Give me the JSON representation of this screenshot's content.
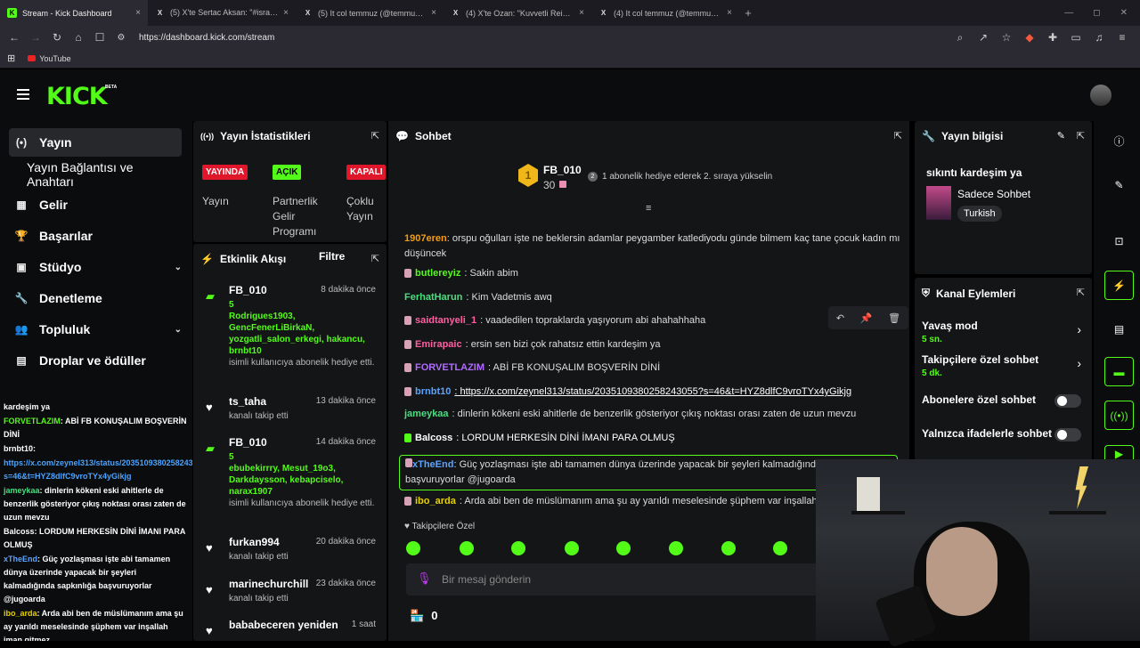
{
  "browser": {
    "tabs": [
      {
        "title": "Stream - Kick Dashboard",
        "icon": "K",
        "active": true
      },
      {
        "title": "(5) X'te Sertac Aksan: \"#israil 🔴 Ara",
        "icon": "X"
      },
      {
        "title": "(5) It col temmuz (@temmuz1919) / X",
        "icon": "X"
      },
      {
        "title": "(4) X'te Ozan: \"Kuvvetli Reis'im bu ok",
        "icon": "X"
      },
      {
        "title": "(4) It col temmuz (@temmuz1919) / X",
        "icon": "X"
      }
    ],
    "url": "https://dashboard.kick.com/stream",
    "bookmark": "YouTube"
  },
  "logo": {
    "text": "KICK",
    "beta": "BETA"
  },
  "sidebar": {
    "items": [
      {
        "label": "Yayın",
        "icon": "(•)"
      },
      {
        "label": "Yayın Bağlantısı ve Anahtarı",
        "icon": ""
      },
      {
        "label": "Gelir",
        "icon": "▦"
      },
      {
        "label": "Başarılar",
        "icon": "🏆"
      },
      {
        "label": "Stüdyo",
        "icon": "▣"
      },
      {
        "label": "Denetleme",
        "icon": "🔧"
      },
      {
        "label": "Topluluk",
        "icon": "👥"
      },
      {
        "label": "Droplar ve ödüller",
        "icon": "▤"
      }
    ]
  },
  "overlay_chat": [
    {
      "user": "",
      "text": "kardeşim ya",
      "color": "#fff"
    },
    {
      "user": "FORVETLAZIM",
      "text": ": ABİ FB KONUŞALIM BOŞVERİN DİNİ",
      "color": "#53fc18"
    },
    {
      "user": "brnbt10",
      "text": ":",
      "color": "#fff"
    },
    {
      "user": "",
      "text": "https://x.com/zeynel313/status/2035109380258243055?s=46&t=HYZ8dlfC9vroTYx4yGikjg",
      "color": "#4aa3ff"
    },
    {
      "user": "jameykaa",
      "text": ": dinlerin kökeni eski ahitlerle de benzerlik gösteriyor çıkış noktası orası zaten de uzun mevzu",
      "color": "#4ade80"
    },
    {
      "user": "Balcoss",
      "text": ": LORDUM HERKESİN DİNİ İMANI PARA OLMUŞ",
      "color": "#fff"
    },
    {
      "user": "xTheEnd",
      "text": ": Güç yozlaşması işte abi tamamen dünya üzerinde yapacak bir şeyleri kalmadığında sapkınlığa başvuruyorlar @jugoarda",
      "color": "#5ba3ff"
    },
    {
      "user": "ibo_arda",
      "text": ": Arda abi ben de müslümanım ama şu ay yarıldı meselesinde şüphem var inşallah iman gitmez",
      "color": "#e6d100"
    }
  ],
  "stats": {
    "title": "Yayın İstatistikleri",
    "badges": [
      {
        "label": "YAYINDA",
        "color": "#e0162b",
        "text_color": "#fff"
      },
      {
        "label": "AÇIK",
        "color": "#53fc18",
        "text_color": "#000"
      },
      {
        "label": "KAPALI",
        "color": "#e0162b",
        "text_color": "#fff"
      }
    ],
    "labels": [
      "Yayın",
      "Partnerlik Gelir Programı",
      "Çoklu Yayın"
    ]
  },
  "activity": {
    "title": "Etkinlik Akışı",
    "filter": "Filtre",
    "items": [
      {
        "user": "FB_010",
        "time": "8 dakika önce",
        "count": "5",
        "names": "Rodrigues1903, GencFenerLiBirkaN, yozgatli_salon_erkegi, hakancu, brnbt10",
        "desc": "isimli kullanıcıya abonelik hediye etti.",
        "type": "gift"
      },
      {
        "user": "ts_taha",
        "time": "13 dakika önce",
        "desc": "kanalı takip etti",
        "type": "follow"
      },
      {
        "user": "FB_010",
        "time": "14 dakika önce",
        "count": "5",
        "names": "ebubekirrry, Mesut_19o3, Darkdaysson, kebapciselo, narax1907",
        "desc": "isimli kullanıcıya abonelik hediye etti.",
        "type": "gift"
      },
      {
        "user": "furkan994",
        "time": "20 dakika önce",
        "desc": "kanalı takip etti",
        "type": "follow"
      },
      {
        "user": "marinechurchill",
        "time": "23 dakika önce",
        "desc": "kanalı takip etti",
        "type": "follow"
      },
      {
        "user": "bababeceren yeniden",
        "time": "1 saat",
        "desc": "",
        "type": "follow"
      }
    ]
  },
  "chat": {
    "title": "Sohbet",
    "leader": {
      "name": "FB_010",
      "count": "30",
      "rank": "1"
    },
    "promo": "1 abonelik hediye ederek 2. sıraya yükselin",
    "messages": [
      {
        "user": "1907eren",
        "color": "#f39c12",
        "text": ": orspu oğulları işte ne beklersin adamlar peygamber katlediyodu günde bilmem kaç tane çocuk kadın mı düşüncek",
        "badge": false
      },
      {
        "user": "butlereyiz",
        "color": "#53fc18",
        "text": ": Sakin abim",
        "badge": true
      },
      {
        "user": "FerhatHarun",
        "color": "#4ade80",
        "text": ": Kim Vadetmis awq",
        "badge": false
      },
      {
        "user": "saidtanyeli_1",
        "color": "#ff5fa2",
        "text": ": vaadedilen topraklarda yaşıyorum abi ahahahhaha",
        "badge": true
      },
      {
        "user": "Emirapaic",
        "color": "#ff5fa2",
        "text": ": ersin sen bizi çok rahatsız ettin kardeşim ya",
        "badge": true
      },
      {
        "user": "FORVETLAZIM",
        "color": "#b06bff",
        "text": ": ABİ FB KONUŞALIM BOŞVERİN DİNİ",
        "badge": true
      },
      {
        "user": "brnbt10",
        "color": "#5ba3ff",
        "text": ": https://x.com/zeynel313/status/2035109380258243055?s=46&t=HYZ8dlfC9vroTYx4yGikjg",
        "badge": true
      },
      {
        "user": "jameykaa",
        "color": "#4ade80",
        "text": ": dinlerin kökeni eski ahitlerle de benzerlik gösteriyor çıkış noktası orası zaten de uzun mevzu",
        "badge": false
      },
      {
        "user": "Balcoss",
        "color": "#fff",
        "text": ": LORDUM HERKESİN DİNİ İMANI PARA OLMUŞ",
        "badge": true
      },
      {
        "user": "xTheEnd",
        "color": "#5ba3ff",
        "text": ": Güç yozlaşması işte abi tamamen dünya üzerinde yapacak bir şeyleri kalmadığında sapkınlığa başvuruyorlar @jugoarda",
        "badge": true
      },
      {
        "user": "ibo_arda",
        "color": "#e6d100",
        "text": ": Arda abi ben de müslümanım ama şu ay yarıldı meselesinde şüphem var inşallah iman gitmez",
        "badge": true
      }
    ],
    "followers_only": "Takipçilere Özel",
    "placeholder": "Bir mesaj gönderin",
    "points": "0"
  },
  "info": {
    "title": "Yayın bilgisi",
    "stream_title": "sıkıntı kardeşim ya",
    "category": "Sadece Sohbet",
    "language": "Turkish"
  },
  "channel": {
    "title": "Kanal Eylemleri",
    "items": [
      {
        "label": "Yavaş mod",
        "value": "5 sn.",
        "kind": "arrow"
      },
      {
        "label": "Takipçilere özel sohbet",
        "value": "5 dk.",
        "kind": "arrow"
      },
      {
        "label": "Abonelere özel sohbet",
        "value": "",
        "kind": "toggle"
      },
      {
        "label": "Yalnızca ifadelerle sohbet",
        "value": "",
        "kind": "toggle"
      }
    ]
  }
}
